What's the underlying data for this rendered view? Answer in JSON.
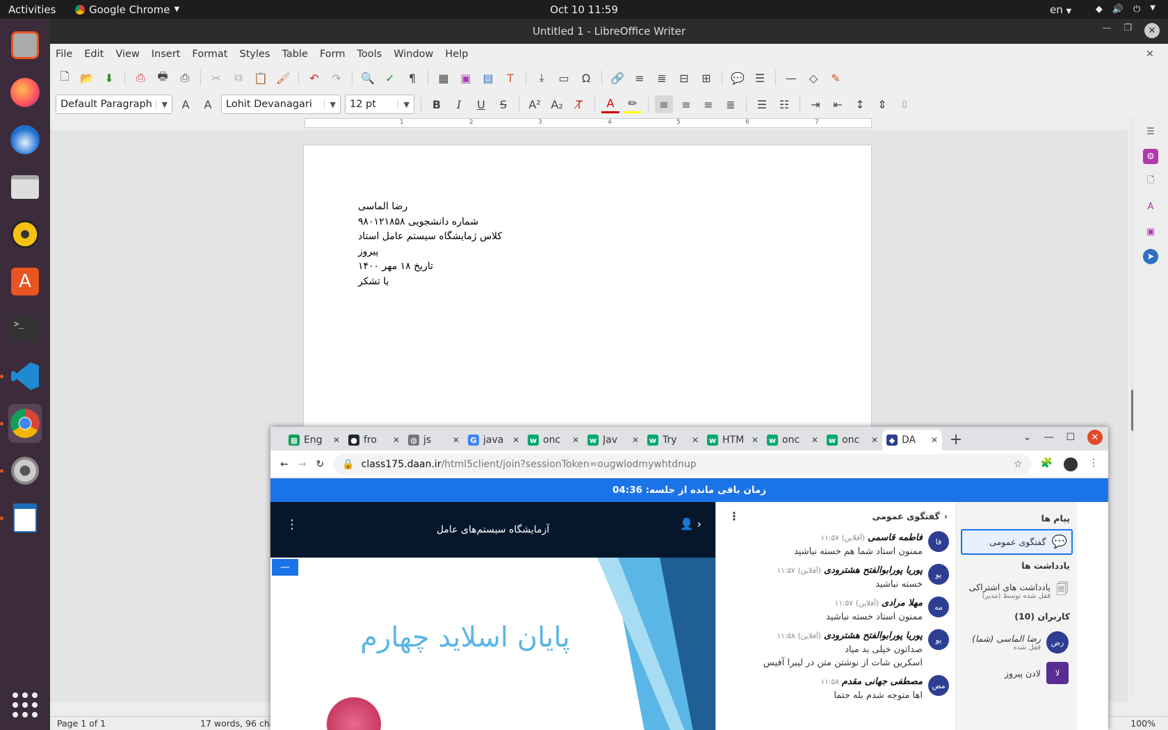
{
  "topbar": {
    "activities": "Activities",
    "app": "Google Chrome",
    "clock": "Oct 10  11:59",
    "lang": "en"
  },
  "dock": {
    "items": [
      "ubuntu-installer-icon",
      "firefox-icon",
      "thunderbird-icon",
      "files-icon",
      "rhythmbox-icon",
      "software-icon",
      "terminal-icon",
      "vscode-icon",
      "chrome-icon",
      "settings-icon",
      "writer-icon"
    ]
  },
  "writer": {
    "title": "Untitled 1 - LibreOffice Writer",
    "menu": [
      "File",
      "Edit",
      "View",
      "Insert",
      "Format",
      "Styles",
      "Table",
      "Form",
      "Tools",
      "Window",
      "Help"
    ],
    "paragraph_style": "Default Paragraph",
    "font_name": "Lohit Devanagari",
    "font_size": "12 pt",
    "ruler_marks": [
      "1",
      "2",
      "3",
      "4",
      "5",
      "6",
      "7"
    ],
    "doc_lines": [
      "رضا الماسی",
      "شماره دانشجویی ۹۸۰۱۲۱۸۵۸",
      "کلاس ژمایشگاه سیستم عامل استاد پیروز",
      "تاریخ ۱۸ مهر ۱۴۰۰",
      "با تشکر"
    ],
    "status": {
      "page": "Page 1 of 1",
      "words": "17 words, 96 cha",
      "zoom": "100%"
    }
  },
  "chrome": {
    "tabs": [
      {
        "label": "Eng",
        "color": "#0f9d58",
        "glyph": "▦"
      },
      {
        "label": "fro",
        "color": "#24292e",
        "glyph": "●"
      },
      {
        "label": "js",
        "color": "#777777",
        "glyph": "◍"
      },
      {
        "label": "java",
        "color": "#4285f4",
        "glyph": "G"
      },
      {
        "label": "onc",
        "color": "#04aa6d",
        "glyph": "w"
      },
      {
        "label": "Jav",
        "color": "#04aa6d",
        "glyph": "w"
      },
      {
        "label": "Try",
        "color": "#04aa6d",
        "glyph": "w"
      },
      {
        "label": "HTM",
        "color": "#04aa6d",
        "glyph": "w"
      },
      {
        "label": "onc",
        "color": "#04aa6d",
        "glyph": "w"
      },
      {
        "label": "onc",
        "color": "#04aa6d",
        "glyph": "w"
      },
      {
        "label": "DA",
        "color": "#2d3e93",
        "glyph": "◆"
      }
    ],
    "url_host": "class175.daan.ir",
    "url_path": "/html5client/join?sessionToken=ougwlodmywhtdnup",
    "timer": "زمان باقی مانده از جلسه: 04:36",
    "presentation_title": "آزمایشگاه سیستم‌های عامل",
    "slide_text": "پایان اسلاید چهارم",
    "chat_title": "گفتگوی عمومی",
    "messages": [
      {
        "avatar": "فا",
        "name": "فاطمه قاسمی",
        "status": "(آفلاین)",
        "time": "۱۱:۵۷",
        "lines": [
          "ممنون استاد شما هم خسته نباشید"
        ]
      },
      {
        "avatar": "پو",
        "name": "پوریا پورابوالفتح هشترودی",
        "status": "(آفلاین)",
        "time": "۱۱:۵۷",
        "lines": [
          "خسته نباشید"
        ]
      },
      {
        "avatar": "مه",
        "name": "مهلا مرادی",
        "status": "(آفلاین)",
        "time": "۱۱:۵۷",
        "lines": [
          "ممنون استاد خسته نباشید"
        ]
      },
      {
        "avatar": "پو",
        "name": "پوریا پورابوالفتح هشترودی",
        "status": "(آفلاین)",
        "time": "۱۱:۵۸",
        "lines": [
          "صداتون خیلی بد میاد",
          "اسکرین شات از نوشتن متن در لیبرا آفیس"
        ]
      },
      {
        "avatar": "مص",
        "name": "مصطفی جهانی مقدم",
        "status": "",
        "time": "۱۱:۵۸",
        "lines": [
          "اها متوجه شدم بله حتما"
        ]
      }
    ],
    "userlist": {
      "messages_h": "پیام ها",
      "public_chat": "گفتگوی عمومی",
      "notes_h": "یادداشت ها",
      "shared_notes": "یادداشت های اشتراکی",
      "shared_notes_sub": "قفل شده توسط (مدیر)",
      "users_h": "کاربران (10)",
      "users": [
        {
          "avatar": "رض",
          "name": "رضا الماسی (شما)",
          "sub": "قفل شده",
          "color": "#2d3e93"
        },
        {
          "avatar": "لا",
          "name": "لادن پیروز",
          "sub": "",
          "color": "#5b2d93"
        }
      ]
    }
  }
}
